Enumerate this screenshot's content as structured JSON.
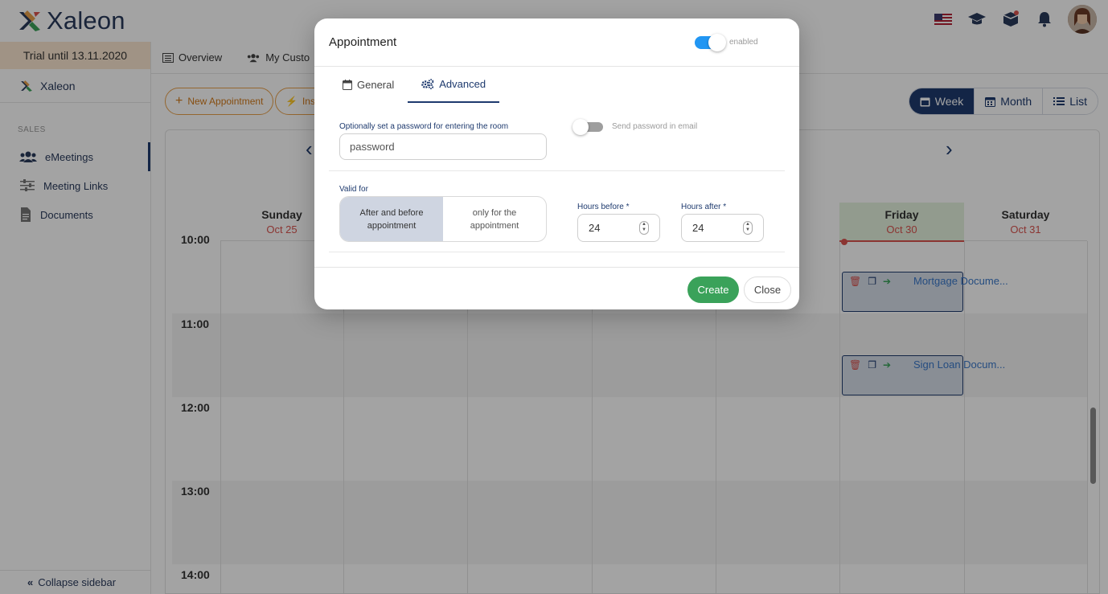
{
  "app": {
    "brand": "Xaleon"
  },
  "sidebar": {
    "trial": "Trial until 13.11.2020",
    "org": "Xaleon",
    "section": "SALES",
    "items": [
      {
        "label": "eMeetings",
        "icon": "users-icon"
      },
      {
        "label": "Meeting Links",
        "icon": "sliders-icon"
      },
      {
        "label": "Documents",
        "icon": "document-icon"
      }
    ],
    "collapse": "Collapse sidebar"
  },
  "nav": {
    "tabs": [
      "Overview",
      "My Custo"
    ]
  },
  "actions": {
    "new_appointment": "New Appointment",
    "instant": "Insta"
  },
  "views": {
    "week": "Week",
    "month": "Month",
    "list": "List",
    "active": "Week"
  },
  "calendar": {
    "days": [
      {
        "name": "Sunday",
        "date": "Oct 25"
      },
      {
        "name": "Friday",
        "date": "Oct 30"
      },
      {
        "name": "Saturday",
        "date": "Oct 31"
      }
    ],
    "hours": [
      "10:00",
      "11:00",
      "12:00",
      "13:00",
      "14:00"
    ],
    "events": [
      {
        "title": "Mortgage Docume..."
      },
      {
        "title": "Sign Loan Docum..."
      }
    ]
  },
  "modal": {
    "title": "Appointment",
    "enabled_label": "enabled",
    "enabled": true,
    "tabs": [
      "General",
      "Advanced"
    ],
    "active_tab": "Advanced",
    "password_label": "Optionally set a password for entering the room",
    "password_placeholder": "password",
    "send_password_label": "Send password in email",
    "send_password": false,
    "valid_for_label": "Valid for",
    "valid_options": [
      "After and before appointment",
      "only for the appointment"
    ],
    "valid_selected": "After and before appointment",
    "hours_before_label": "Hours before *",
    "hours_before": "24",
    "hours_after_label": "Hours after *",
    "hours_after": "24",
    "create": "Create",
    "close": "Close"
  },
  "colors": {
    "primary": "#1e3a6e",
    "accent": "#2196f3",
    "success": "#3aa25a",
    "warning": "#e8a04a",
    "danger": "#d9534f"
  }
}
